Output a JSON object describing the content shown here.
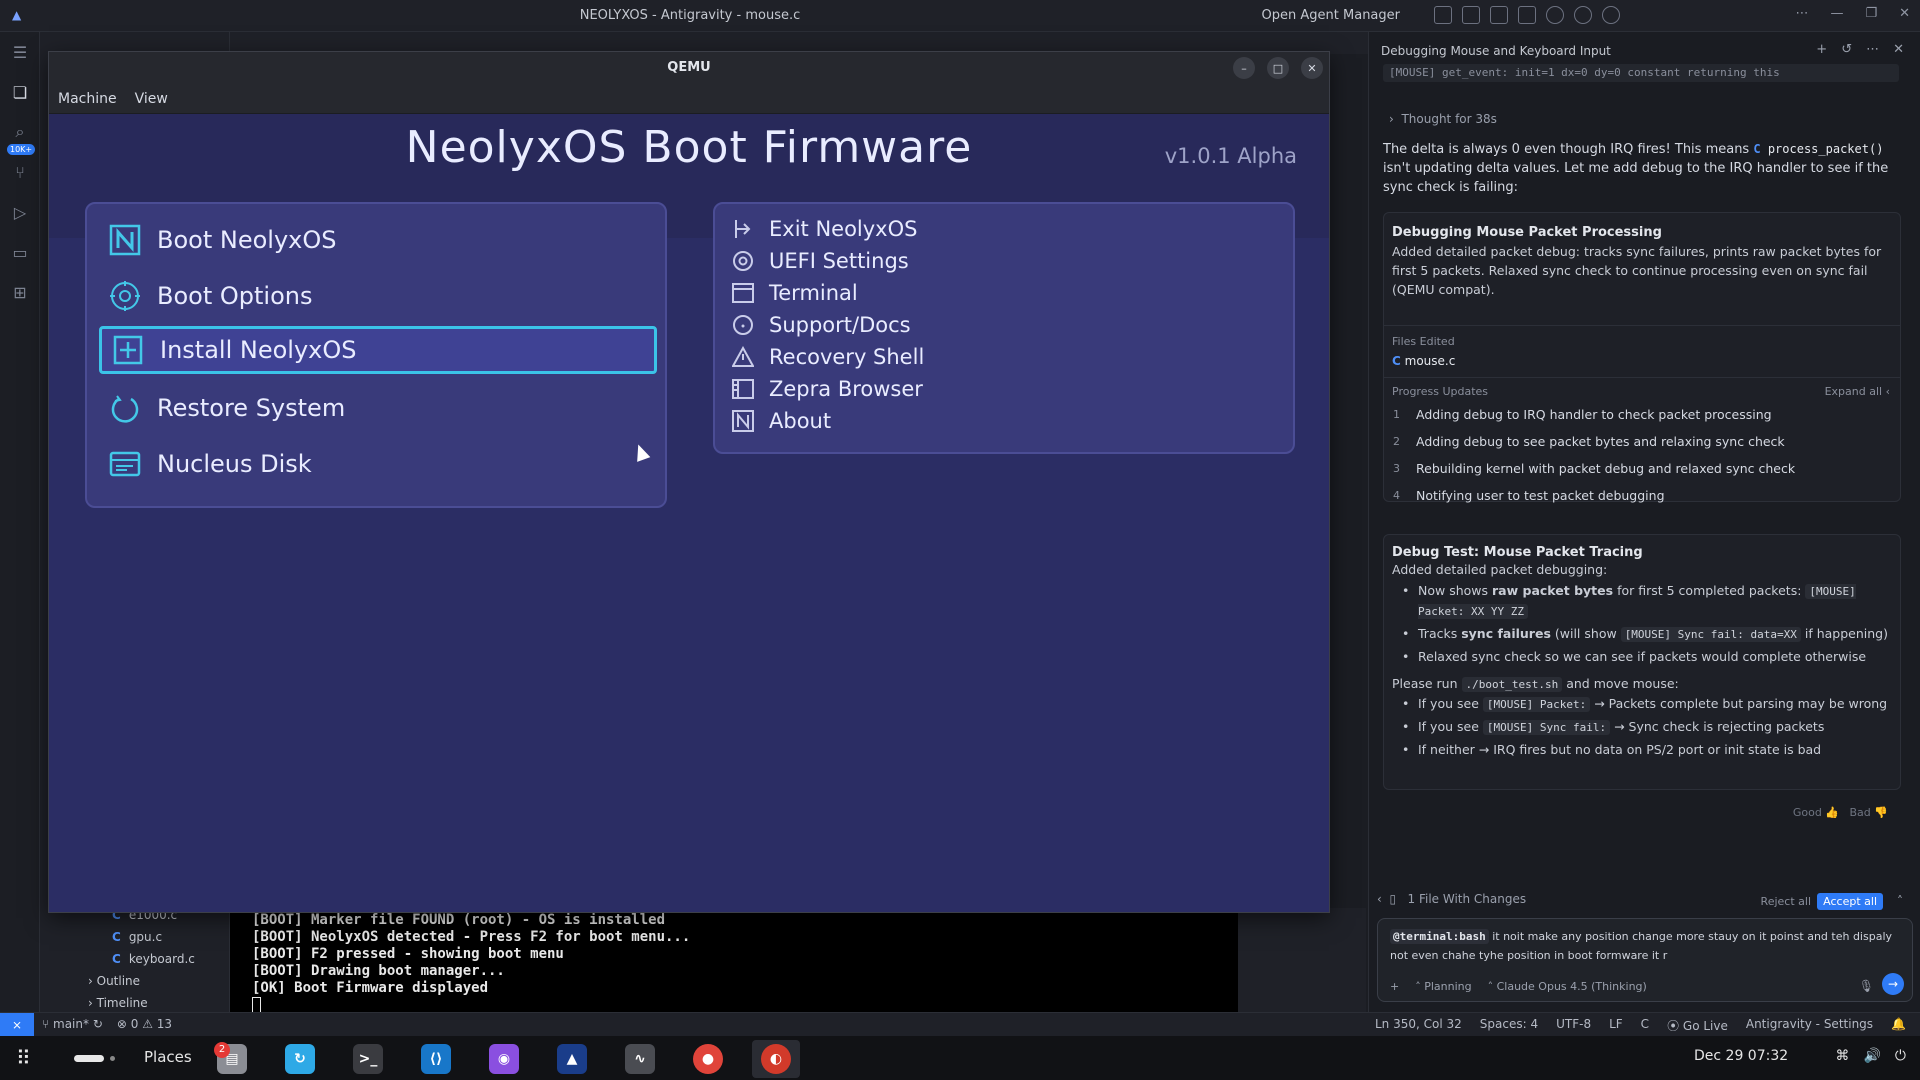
{
  "titlebar": {
    "title": "NEOLYXOS - Antigravity - mouse.c",
    "open_agent_manager": "Open Agent Manager"
  },
  "activity": {
    "badge": "10K+"
  },
  "explorer": {
    "files": [
      "e1000.c",
      "gpu.c",
      "keyboard.c"
    ],
    "sections": [
      "Outline",
      "Timeline"
    ]
  },
  "qemu": {
    "title": "QEMU",
    "menu": [
      "Machine",
      "View"
    ],
    "firmware_title": "NeolyxOS Boot Firmware",
    "version": "v1.0.1 Alpha",
    "left_menu": [
      {
        "label": "Boot NeolyxOS",
        "icon": "neolyx-logo-icon"
      },
      {
        "label": "Boot Options",
        "icon": "gear-icon"
      },
      {
        "label": "Install NeolyxOS",
        "icon": "plus-box-icon",
        "selected": true
      },
      {
        "label": "Restore System",
        "icon": "restore-icon"
      },
      {
        "label": "Nucleus Disk",
        "icon": "disk-icon"
      }
    ],
    "right_menu": [
      {
        "label": "Exit NeolyxOS",
        "icon": "exit-icon"
      },
      {
        "label": "UEFI Settings",
        "icon": "gear-icon"
      },
      {
        "label": "Terminal",
        "icon": "terminal-icon"
      },
      {
        "label": "Support/Docs",
        "icon": "help-icon"
      },
      {
        "label": "Recovery Shell",
        "icon": "warning-icon"
      },
      {
        "label": "Zepra Browser",
        "icon": "browser-icon"
      },
      {
        "label": "About",
        "icon": "neolyx-logo-icon"
      }
    ]
  },
  "terminal": {
    "lines": [
      "[BOOT] Marker file FOUND (root) - OS is installed",
      "[BOOT] NeolyxOS detected - Press F2 for boot menu...",
      "[BOOT] F2 pressed - showing boot menu",
      "[BOOT] Drawing boot manager...",
      "[OK] Boot Firmware displayed"
    ]
  },
  "chat": {
    "header": "Debugging Mouse and Keyboard Input",
    "top_code": "[MOUSE] get_event: init=1 dx=0 dy=0 constant returning this",
    "thought": "Thought for 38s",
    "para_pre": "The delta is always 0 even though IRQ fires! This means",
    "para_fn": "process_packet()",
    "para_post": "isn't updating delta values. Let me add debug to the IRQ handler to see if the sync check is failing:",
    "card1": {
      "title": "Debugging Mouse Packet Processing",
      "body": "Added detailed packet debug: tracks sync failures, prints raw packet bytes for first 5 packets. Relaxed sync check to continue processing even on sync fail (QEMU compat).",
      "files_label": "Files Edited",
      "file": "mouse.c",
      "progress_label": "Progress Updates",
      "expand_all": "Expand all",
      "progress": [
        "Adding debug to IRQ handler to check packet processing",
        "Adding debug to see packet bytes and relaxing sync check",
        "Rebuilding kernel with packet debug and relaxed sync check",
        "Notifying user to test packet debugging"
      ]
    },
    "card2": {
      "title": "Debug Test: Mouse Packet Tracing",
      "intro": "Added detailed packet debugging:",
      "b1_pre": "Now shows",
      "b1_bold": "raw packet bytes",
      "b1_mid": "for first 5 completed packets:",
      "b1_code": "[MOUSE] Packet: XX YY ZZ",
      "b2_pre": "Tracks",
      "b2_bold": "sync failures",
      "b2_mid": "(will show",
      "b2_code": "[MOUSE] Sync fail: data=XX",
      "b2_post": "if happening)",
      "b3": "Relaxed sync check so we can see if packets would complete otherwise",
      "run_pre": "Please run",
      "run_code": "./boot_test.sh",
      "run_post": "and move mouse:",
      "r1_pre": "If you see",
      "r1_code": "[MOUSE] Packet:",
      "r1_post": "→ Packets complete but parsing may be wrong",
      "r2_pre": "If you see",
      "r2_code": "[MOUSE] Sync fail:",
      "r2_post": "→ Sync check is rejecting packets",
      "r3": "If neither → IRQ fires but no data on PS/2 port or init state is bad"
    },
    "good": "Good",
    "bad": "Bad",
    "changes": "1 File With Changes",
    "reject": "Reject all",
    "accept": "Accept all",
    "mention": "@terminal:bash",
    "input_text": "it noit make any position change more stauy on it poinst and teh dispaly not even chahe tyhe position in boot formware it r",
    "mode": "Planning",
    "model": "Claude Opus 4.5 (Thinking)"
  },
  "statusbar": {
    "branch": "main*",
    "problems": "0 ⚠ 13",
    "position": "Ln 350, Col 32",
    "spaces": "Spaces: 4",
    "encoding": "UTF-8",
    "eol": "LF",
    "lang": "C",
    "golive": "Go Live",
    "settings": "Antigravity - Settings"
  },
  "taskbar": {
    "places": "Places",
    "files_badge": "2",
    "clock": "Dec 29  07:32"
  }
}
